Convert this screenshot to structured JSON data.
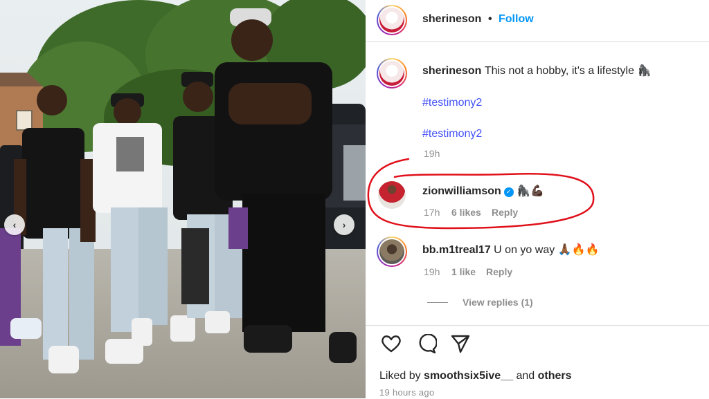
{
  "post": {
    "author": "sherineson",
    "dot": "•",
    "follow_label": "Follow"
  },
  "caption": {
    "author": "sherineson",
    "text": "This not a hobby, it's a lifestyle 🦍",
    "hashtags": [
      "#testimony2",
      "#testimony2"
    ],
    "time": "19h"
  },
  "comments": [
    {
      "author": "zionwilliamson",
      "verified": true,
      "text": "🦍💪🏿",
      "time": "17h",
      "likes": "6 likes",
      "reply_label": "Reply",
      "highlighted": true
    },
    {
      "author": "bb.m1treal17",
      "verified": false,
      "text": "U on yo way 🙏🏾🔥🔥",
      "time": "19h",
      "likes": "1 like",
      "reply_label": "Reply",
      "view_replies": "View replies (1)"
    }
  ],
  "footer": {
    "liked_prefix": "Liked by ",
    "liked_user": "smoothsix5ive__",
    "liked_and": " and ",
    "liked_others": "others",
    "time_ago": "19 hours ago"
  },
  "icons": {
    "like": "heart-icon",
    "comment": "comment-icon",
    "share": "paper-plane-icon",
    "prev": "chevron-left-icon",
    "next": "chevron-right-icon",
    "verified": "verified-badge-icon"
  },
  "colors": {
    "follow": "#0095f6",
    "hashtag": "#4150f7",
    "highlight_circle": "#e0101a",
    "muted": "#8e8e8e"
  }
}
